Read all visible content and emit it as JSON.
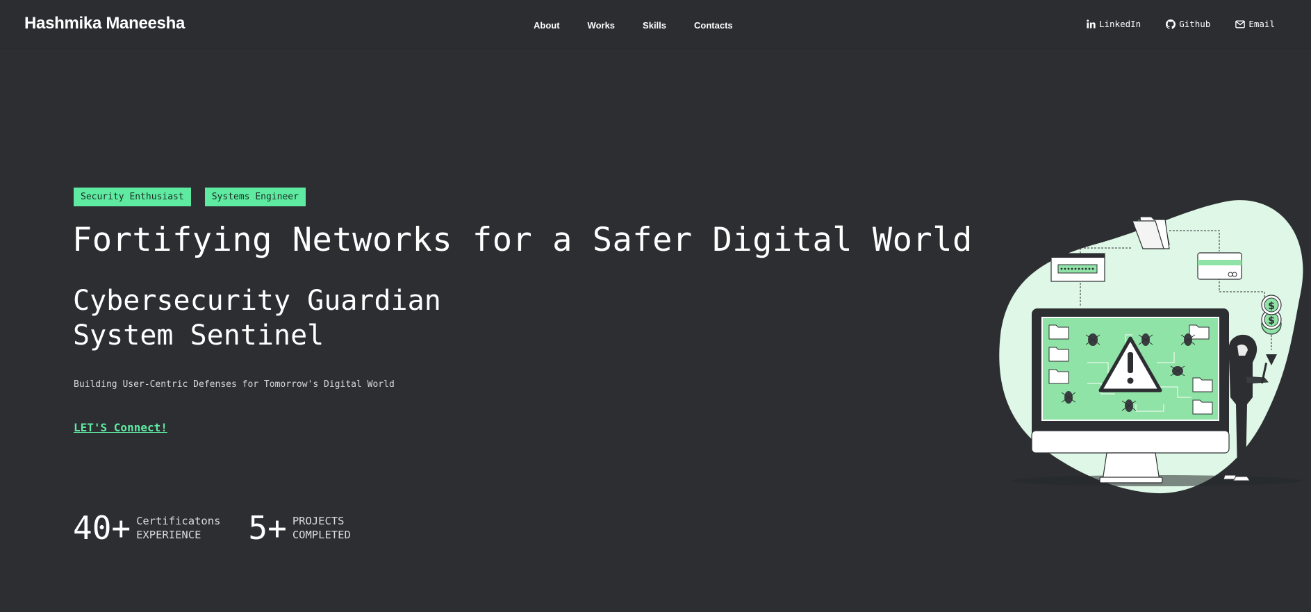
{
  "brand": "Hashmika Maneesha",
  "nav": {
    "items": [
      "About",
      "Works",
      "Skills",
      "Contacts"
    ]
  },
  "social": {
    "linkedin": "LinkedIn",
    "github": "Github",
    "email": "Email"
  },
  "hero": {
    "tags": [
      "Security Enthusiast",
      "Systems Engineer"
    ],
    "headline": "Fortifying Networks for a Safer Digital World",
    "roles": [
      "Cybersecurity Guardian",
      "System Sentinel"
    ],
    "tagline": "Building User-Centric Defenses for Tomorrow's Digital World",
    "cta": "LET'S Connect!"
  },
  "stats": [
    {
      "value": "40+",
      "label_line1": "Certificatons",
      "label_line2": "EXPERIENCE"
    },
    {
      "value": "5+",
      "label_line1": "PROJECTS",
      "label_line2": "COMPLETED"
    }
  ],
  "colors": {
    "background": "#2c2e32",
    "accent": "#5eeba1",
    "blob": "#dff7e6",
    "screen": "#8fe3a6"
  },
  "icons": [
    "linkedin-icon",
    "github-icon",
    "email-icon",
    "warning-icon",
    "dollar-coin-icon",
    "folder-icon"
  ]
}
